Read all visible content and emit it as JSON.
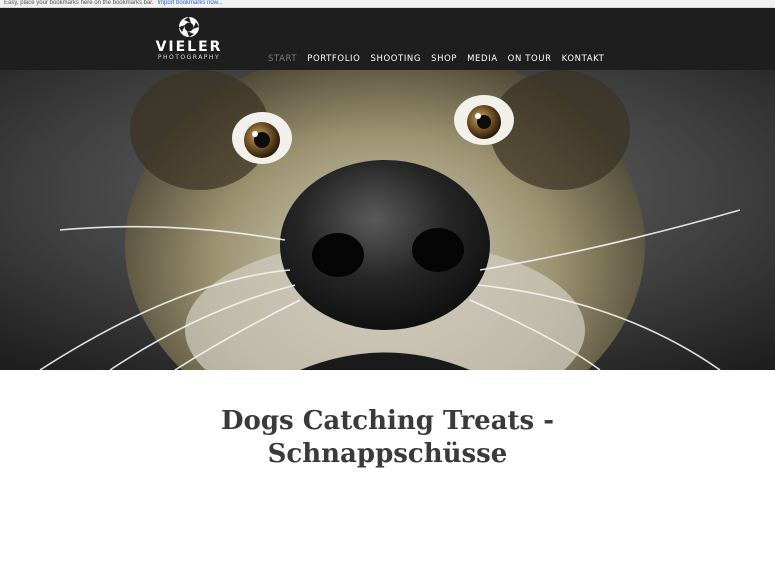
{
  "bookmarks_bar": {
    "text": "Easy, place your bookmarks here on the bookmarks bar.",
    "link": "Import bookmarks now..."
  },
  "site": {
    "logo_name": "VIELER",
    "logo_sub": "PHOTOGRAPHY",
    "nav": [
      {
        "label": "START",
        "active": true
      },
      {
        "label": "PORTFOLIO",
        "active": false
      },
      {
        "label": "SHOOTING",
        "active": false
      },
      {
        "label": "SHOP",
        "active": false
      },
      {
        "label": "MEDIA",
        "active": false
      },
      {
        "label": "ON TOUR",
        "active": false
      },
      {
        "label": "KONTAKT",
        "active": false
      }
    ]
  },
  "hero": {
    "subject": "dog-catching-treat-photo"
  },
  "article": {
    "title_line1": "Dogs Catching Treats -",
    "title_line2": "Schnappschüsse"
  },
  "colors": {
    "header_bg": "#1e1e1e",
    "nav_active": "#7a7a7a",
    "nav_default": "#ffffff",
    "title_text": "#3a3a3a"
  }
}
